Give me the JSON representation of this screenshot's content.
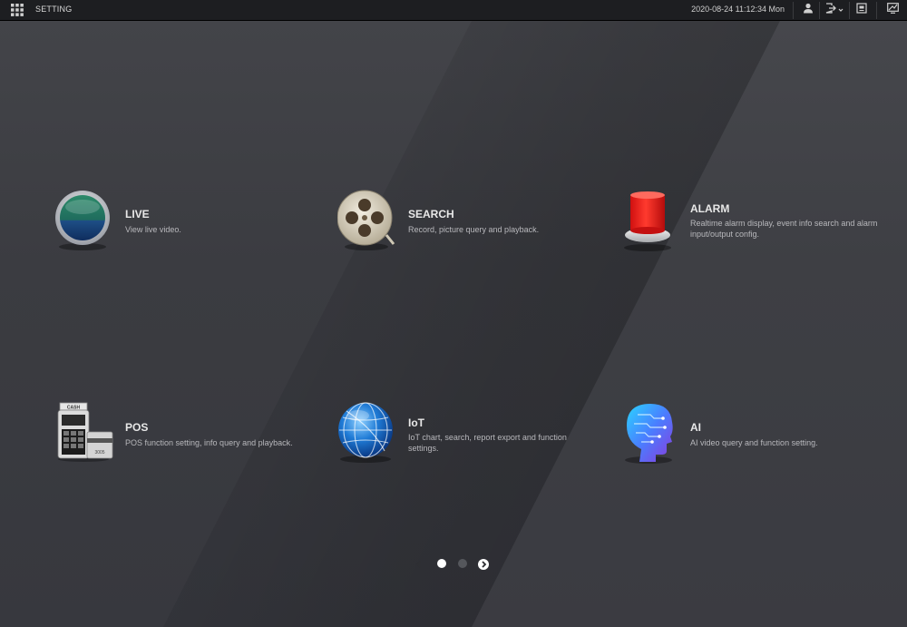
{
  "header": {
    "title": "SETTING",
    "datetime": "2020-08-24 11:12:34 Mon",
    "icons": [
      "apps-grid-icon",
      "user-icon",
      "logout-icon",
      "fullscreen-icon",
      "display-icon"
    ]
  },
  "tiles": [
    {
      "name": "LIVE",
      "desc": "View live video.",
      "icon": "live-icon"
    },
    {
      "name": "SEARCH",
      "desc": "Record, picture query and playback.",
      "icon": "film-reel-icon"
    },
    {
      "name": "ALARM",
      "desc": "Realtime alarm display, event info search and alarm input/output config.",
      "icon": "alarm-siren-icon"
    },
    {
      "name": "POS",
      "desc": "POS function setting, info query and playback.",
      "icon": "cash-register-icon"
    },
    {
      "name": "IoT",
      "desc": "IoT chart, search, report export and function settings.",
      "icon": "globe-icon"
    },
    {
      "name": "AI",
      "desc": "AI video query and function setting.",
      "icon": "ai-head-icon"
    }
  ],
  "pos_icon_text": {
    "cash": "CASH",
    "card": "3005"
  },
  "pager": {
    "pages": 2,
    "current": 1
  },
  "colors": {
    "topbar": "#1d1e21",
    "background": "#3a3b40",
    "title_text": "#e8e8e8",
    "desc_text": "#b8b8bc"
  }
}
